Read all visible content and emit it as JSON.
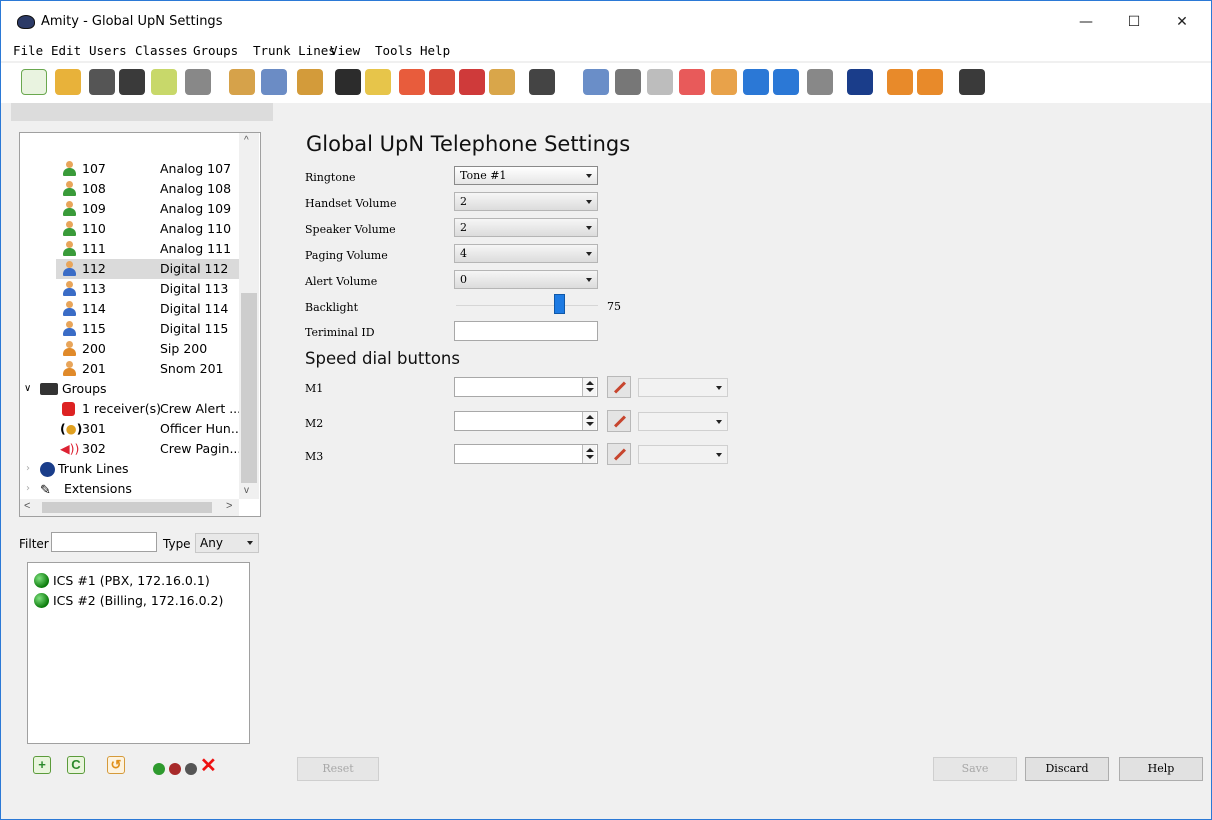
{
  "window": {
    "title": "Amity - Global UpN Settings",
    "minimize": "—",
    "maximize": "☐",
    "close": "✕"
  },
  "menu": [
    "File",
    "Edit",
    "Users",
    "Classes",
    "Groups",
    "Trunk Lines",
    "View",
    "Tools",
    "Help"
  ],
  "tree": {
    "rows": [
      {
        "num": "107",
        "name": "Analog 107"
      },
      {
        "num": "108",
        "name": "Analog 108"
      },
      {
        "num": "109",
        "name": "Analog 109"
      },
      {
        "num": "110",
        "name": "Analog 110"
      },
      {
        "num": "111",
        "name": "Analog 111"
      },
      {
        "num": "112",
        "name": "Digital 112"
      },
      {
        "num": "113",
        "name": "Digital 113"
      },
      {
        "num": "114",
        "name": "Digital 114"
      },
      {
        "num": "115",
        "name": "Digital 115"
      },
      {
        "num": "200",
        "name": "Sip 200"
      },
      {
        "num": "201",
        "name": "Snom 201"
      }
    ],
    "groups_label": "Groups",
    "group_rows": [
      {
        "num": "1 receiver(s)",
        "name": "Crew Alert ..."
      },
      {
        "num": "301",
        "name": "Officer Hun..."
      },
      {
        "num": "302",
        "name": "Crew Pagin..."
      }
    ],
    "trunk_lines_label": "Trunk Lines",
    "extensions_label": "Extensions"
  },
  "filter": {
    "label": "Filter",
    "value": "",
    "type_label": "Type",
    "type_value": "Any"
  },
  "ics": [
    "ICS #1 (PBX, 172.16.0.1)",
    "ICS #2 (Billing, 172.16.0.2)"
  ],
  "main": {
    "title": "Global UpN Telephone Settings",
    "fields": {
      "ringtone": {
        "label": "Ringtone",
        "value": "Tone #1"
      },
      "handset": {
        "label": "Handset Volume",
        "value": "2"
      },
      "speaker": {
        "label": "Speaker Volume",
        "value": "2"
      },
      "paging": {
        "label": "Paging Volume",
        "value": "4"
      },
      "alert": {
        "label": "Alert Volume",
        "value": "0"
      },
      "backlight": {
        "label": "Backlight",
        "value": "75",
        "level": 75
      },
      "terminal": {
        "label": "Teriminal ID",
        "value": ""
      }
    },
    "speed_title": "Speed dial buttons",
    "speed": [
      {
        "label": "M1",
        "value": ""
      },
      {
        "label": "M2",
        "value": ""
      },
      {
        "label": "M3",
        "value": ""
      }
    ]
  },
  "buttons": {
    "reset": "Reset",
    "save": "Save",
    "discard": "Discard",
    "help": "Help"
  }
}
